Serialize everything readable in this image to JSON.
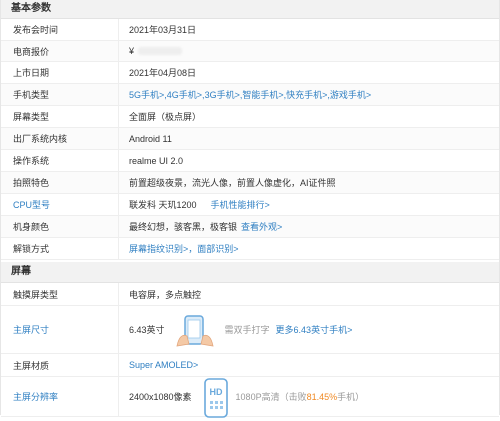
{
  "sections": {
    "basic_title": "基本参数",
    "screen_title": "屏幕"
  },
  "rows": {
    "release_time": {
      "label": "发布会时间",
      "value": "2021年03月31日"
    },
    "price": {
      "label": "电商报价",
      "value": "¥"
    },
    "launch_date": {
      "label": "上市日期",
      "value": "2021年04月08日"
    },
    "phone_type": {
      "label": "手机类型",
      "links": [
        "5G手机>",
        "4G手机>",
        "3G手机>",
        "智能手机>",
        "快充手机>",
        "游戏手机>"
      ],
      "sep": ","
    },
    "screen_type": {
      "label": "屏幕类型",
      "value": "全面屏（极点屏）"
    },
    "os_kernel": {
      "label": "出厂系统内核",
      "value": "Android 11"
    },
    "os": {
      "label": "操作系统",
      "value": "realme UI 2.0"
    },
    "camera": {
      "label": "拍照特色",
      "value": "前置超级夜景，流光人像，前置人像虚化，AI证件照"
    },
    "cpu": {
      "label": "CPU型号",
      "value": "联发科 天玑1200",
      "link": "手机性能排行>"
    },
    "color": {
      "label": "机身颜色",
      "value": "最终幻想，骇客黑，极客银",
      "link": "查看外观>"
    },
    "unlock": {
      "label": "解锁方式",
      "links": [
        "屏幕指纹识别>",
        "面部识别>"
      ],
      "sep": "，"
    },
    "touch_type": {
      "label": "触摸屏类型",
      "value": "电容屏，多点触控"
    },
    "screen_size": {
      "label": "主屏尺寸",
      "value": "6.43英寸",
      "hint": "需双手打字",
      "link": "更多6.43英寸手机>"
    },
    "material": {
      "label": "主屏材质",
      "link": "Super AMOLED>"
    },
    "resolution": {
      "label": "主屏分辨率",
      "value": "2400x1080像素",
      "hint_prefix": "1080P高清（击败",
      "hint_pct": "81.45%",
      "hint_suffix": "手机）"
    }
  },
  "colors": {
    "link": "#2f7fc2",
    "accent": "#f08a24",
    "header_bg": "#f2f2f2",
    "illustration": "#6aa9dc"
  }
}
